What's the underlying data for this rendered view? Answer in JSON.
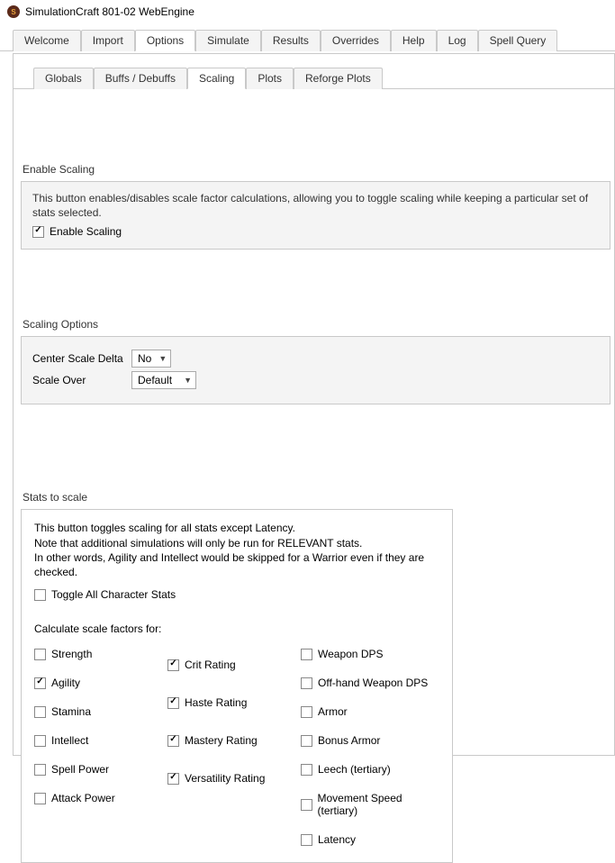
{
  "window": {
    "title": "SimulationCraft 801-02 WebEngine"
  },
  "mainTabs": [
    {
      "label": "Welcome",
      "active": false
    },
    {
      "label": "Import",
      "active": false
    },
    {
      "label": "Options",
      "active": true
    },
    {
      "label": "Simulate",
      "active": false
    },
    {
      "label": "Results",
      "active": false
    },
    {
      "label": "Overrides",
      "active": false
    },
    {
      "label": "Help",
      "active": false
    },
    {
      "label": "Log",
      "active": false
    },
    {
      "label": "Spell Query",
      "active": false
    }
  ],
  "subTabs": [
    {
      "label": "Globals",
      "active": false
    },
    {
      "label": "Buffs / Debuffs",
      "active": false
    },
    {
      "label": "Scaling",
      "active": true
    },
    {
      "label": "Plots",
      "active": false
    },
    {
      "label": "Reforge Plots",
      "active": false
    }
  ],
  "enableScaling": {
    "heading": "Enable Scaling",
    "desc": "This button enables/disables scale factor calculations, allowing you to toggle scaling while keeping a particular set of stats selected.",
    "checkboxLabel": "Enable Scaling",
    "checked": true
  },
  "scalingOptions": {
    "heading": "Scaling Options",
    "centerLabel": "Center Scale Delta",
    "centerValue": "No",
    "scaleOverLabel": "Scale Over",
    "scaleOverValue": "Default"
  },
  "statsToScale": {
    "heading": "Stats to scale",
    "desc1": "This button toggles scaling for all stats except Latency.",
    "desc2": "Note that additional simulations will only be run for RELEVANT stats.",
    "desc3": "In other words, Agility and Intellect would be skipped for a Warrior even if they are checked.",
    "toggleAllLabel": "Toggle All Character Stats",
    "toggleAllChecked": false,
    "subhead": "Calculate scale factors for:",
    "col1": [
      {
        "label": "Strength",
        "checked": false
      },
      {
        "label": "Agility",
        "checked": true
      },
      {
        "label": "Stamina",
        "checked": false
      },
      {
        "label": "Intellect",
        "checked": false
      },
      {
        "label": "Spell Power",
        "checked": false
      },
      {
        "label": "Attack Power",
        "checked": false
      }
    ],
    "col2": [
      {
        "label": "Crit Rating",
        "checked": true
      },
      {
        "label": "Haste Rating",
        "checked": true
      },
      {
        "label": "Mastery Rating",
        "checked": true
      },
      {
        "label": "Versatility Rating",
        "checked": true
      }
    ],
    "col3": [
      {
        "label": "Weapon DPS",
        "checked": false
      },
      {
        "label": "Off-hand Weapon DPS",
        "checked": false
      },
      {
        "label": "Armor",
        "checked": false
      },
      {
        "label": "Bonus Armor",
        "checked": false
      },
      {
        "label": "Leech (tertiary)",
        "checked": false
      },
      {
        "label": "Movement Speed (tertiary)",
        "checked": false
      },
      {
        "label": "Latency",
        "checked": false
      }
    ]
  }
}
